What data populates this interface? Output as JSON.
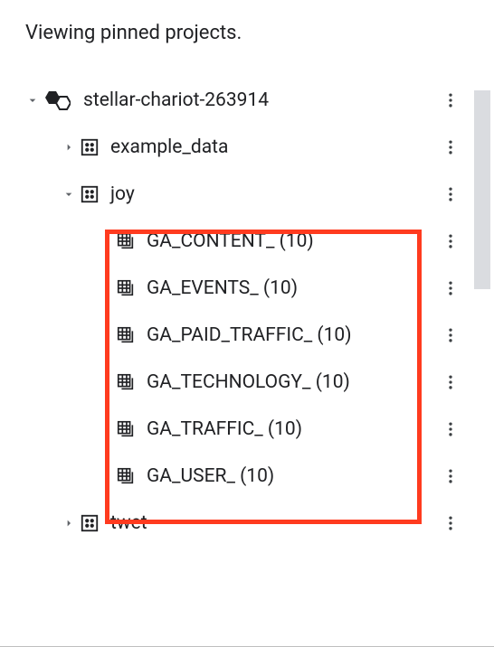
{
  "header": "Viewing pinned projects.",
  "project": {
    "name": "stellar-chariot-263914"
  },
  "datasets": [
    {
      "name": "example_data",
      "expanded": false
    },
    {
      "name": "joy",
      "expanded": true
    },
    {
      "name": "twet",
      "expanded": false
    }
  ],
  "tables": [
    {
      "label": "GA_CONTENT_ (10)"
    },
    {
      "label": "GA_EVENTS_ (10)"
    },
    {
      "label": "GA_PAID_TRAFFIC_ (10)"
    },
    {
      "label": "GA_TECHNOLOGY_ (10)"
    },
    {
      "label": "GA_TRAFFIC_ (10)"
    },
    {
      "label": "GA_USER_ (10)"
    }
  ]
}
